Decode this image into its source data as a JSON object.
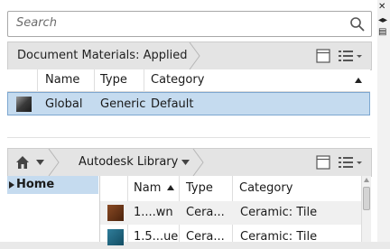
{
  "search": {
    "placeholder": "Search"
  },
  "doc_materials": {
    "title": "Document Materials: Applied"
  },
  "doc_table": {
    "columns": [
      "Name",
      "Type",
      "Category"
    ],
    "rows": [
      {
        "name": "Global",
        "type": "Generic",
        "category": "Default"
      }
    ]
  },
  "library": {
    "title": "Autodesk Library"
  },
  "tree": {
    "home": "Home"
  },
  "library_table": {
    "columns": [
      "Nam",
      "Type",
      "Category"
    ],
    "rows": [
      {
        "name": "1....wn",
        "type": "Cera...",
        "category": "Ceramic: Tile"
      },
      {
        "name": "1.5...ue",
        "type": "Cera...",
        "category": "Ceramic: Tile"
      }
    ]
  },
  "colors": {
    "selection": "#c5dbef",
    "accent": "#7da7d0"
  },
  "icons": [
    "search-icon",
    "view-toggle-icon",
    "list-options-icon",
    "home-icon",
    "sort-up-icon",
    "sort-asc-icon",
    "tree-expand-icon"
  ]
}
